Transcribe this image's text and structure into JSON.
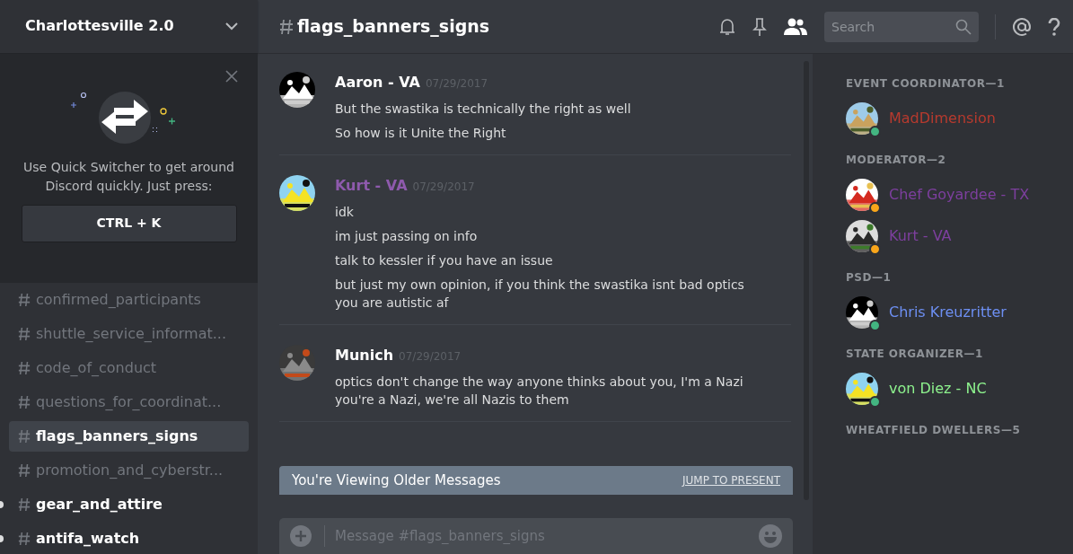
{
  "server": {
    "name": "Charlottesville 2.0"
  },
  "quick_switcher": {
    "text": "Use Quick Switcher to get around Discord quickly. Just press:",
    "shortcut": "CTRL + K"
  },
  "channels": [
    {
      "name": "confirmed_participants",
      "selected": false,
      "unread": false
    },
    {
      "name": "shuttle_service_informat...",
      "selected": false,
      "unread": false
    },
    {
      "name": "code_of_conduct",
      "selected": false,
      "unread": false
    },
    {
      "name": "questions_for_coordinat...",
      "selected": false,
      "unread": false
    },
    {
      "name": "flags_banners_signs",
      "selected": true,
      "unread": false
    },
    {
      "name": "promotion_and_cyberstr...",
      "selected": false,
      "unread": false
    },
    {
      "name": "gear_and_attire",
      "selected": false,
      "unread": true
    },
    {
      "name": "antifa_watch",
      "selected": false,
      "unread": true
    }
  ],
  "header": {
    "channel": "flags_banners_signs",
    "search_placeholder": "Search",
    "members_shown": true
  },
  "messages": [
    {
      "author": "Aaron - VA",
      "color": "#ffffff",
      "time": "07/29/2017",
      "lines": [
        "But the swastika is technically the right as well",
        "So how is it Unite the Right"
      ]
    },
    {
      "author": "Kurt - VA",
      "color": "#8e5aad",
      "time": "07/29/2017",
      "lines": [
        "idk",
        "im just passing on info",
        "talk to kessler if you have an issue",
        "but just my own opinion, if you think the swastika isnt bad optics you are autistic af"
      ]
    },
    {
      "author": "Munich",
      "color": "#ffffff",
      "time": "07/29/2017",
      "lines": [
        "optics don't change the way anyone thinks about you, I'm a Nazi you're a Nazi, we're all Nazis to them"
      ]
    }
  ],
  "older_bar": {
    "text": "You're Viewing Older Messages",
    "action": "JUMP TO PRESENT"
  },
  "composer": {
    "placeholder": "Message #flags_banners_signs"
  },
  "member_groups": [
    {
      "title": "EVENT COORDINATOR—1",
      "members": [
        {
          "name": "MadDimension",
          "color": "#b73a2e",
          "status": {
            "color": "#43b581"
          }
        }
      ]
    },
    {
      "title": "MODERATOR—2",
      "members": [
        {
          "name": "Chef Goyardee - TX",
          "color": "#7d3f9e",
          "status": {
            "color": "#faa61a"
          }
        },
        {
          "name": "Kurt - VA",
          "color": "#7d3f9e",
          "status": {
            "color": "#faa61a"
          }
        }
      ]
    },
    {
      "title": "PSD—1",
      "members": [
        {
          "name": "Chris Kreuzritter",
          "color": "#6d8ff2",
          "status": {
            "color": "#43b581"
          }
        }
      ]
    },
    {
      "title": "STATE ORGANIZER—1",
      "members": [
        {
          "name": "von Diez - NC",
          "color": "#8ef38e",
          "status": {
            "color": "#43b581"
          }
        }
      ]
    },
    {
      "title": "WHEATFIELD DWELLERS—5"
    }
  ]
}
